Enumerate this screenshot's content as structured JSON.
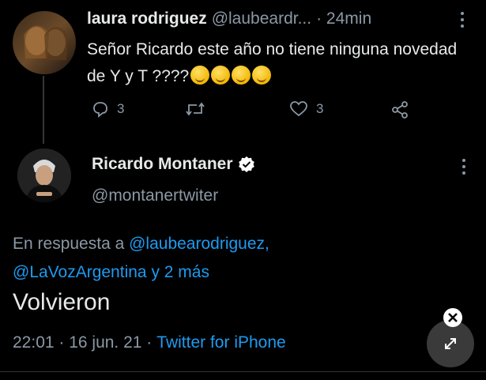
{
  "reply_tweet": {
    "name": "laura rodriguez",
    "handle": "@laubeardr...",
    "time": "· 24min",
    "text": "Señor Ricardo este año no tiene ninguna novedad de Y y T ????",
    "emoji_count": 4,
    "reply_count": "3",
    "retweet_count": "",
    "like_count": "3",
    "icons": [
      "reply-icon",
      "retweet-icon",
      "like-icon",
      "share-icon"
    ]
  },
  "main_tweet": {
    "name": "Ricardo Montaner",
    "handle": "@montanertwiter",
    "reply_prefix": "En respuesta a",
    "reply_to_1": "@laubearodriguez,",
    "reply_to_2": "@LaVozArgentina",
    "reply_suffix": "y 2 más",
    "text": "Volvieron",
    "timestamp": "22:01 · 16 jun. 21 ·",
    "source": "Twitter for iPhone"
  },
  "colors": {
    "background": "#000000",
    "text": "#e7e9ea",
    "muted": "#8b98a5",
    "link": "#1d9bf0",
    "verified": "#ffffff"
  }
}
